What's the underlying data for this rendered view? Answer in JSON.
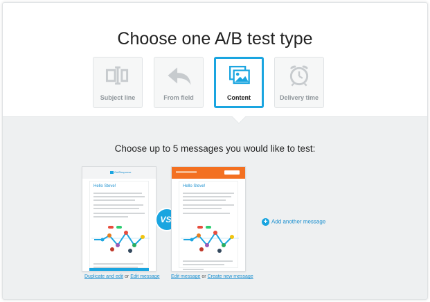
{
  "page": {
    "title": "Choose one A/B test type"
  },
  "types": [
    {
      "label": "Subject line",
      "icon": "text-cursor-icon",
      "selected": false
    },
    {
      "label": "From field",
      "icon": "reply-arrow-icon",
      "selected": false
    },
    {
      "label": "Content",
      "icon": "images-icon",
      "selected": true
    },
    {
      "label": "Delivery time",
      "icon": "alarm-clock-icon",
      "selected": false
    }
  ],
  "messages_section": {
    "subtitle": "Choose up to 5 messages you would like to test:",
    "versus_label": "VS.",
    "message_a": {
      "greeting": "Hello Steve!",
      "links": {
        "duplicate": "Duplicate and edit",
        "or": "or",
        "edit": "Edit message"
      }
    },
    "message_b": {
      "greeting": "Hello Steve!",
      "links": {
        "edit": "Edit message",
        "or": "or",
        "create": "Create new message"
      }
    },
    "add_another": "Add another message"
  },
  "colors": {
    "accent": "#1aa5e0",
    "header_orange": "#f37021",
    "muted_icon": "#c7cbce"
  }
}
